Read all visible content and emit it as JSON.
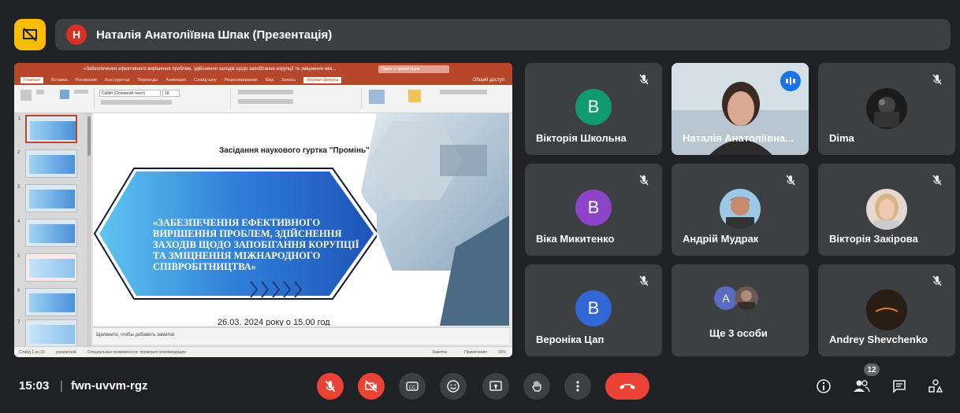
{
  "presenter": {
    "avatar_letter": "Н",
    "name": "Наталія Анатоліївна Шпак (Презентація)"
  },
  "powerpoint": {
    "title": "«Забезпечення ефективного вирішення проблем, здійснення заходів щодо запобігання корупції та зміцнення між...",
    "search_placeholder": "Поиск в презентации",
    "tabs": [
      "Главная",
      "Вставка",
      "Рисование",
      "Конструктор",
      "Переходы",
      "Анимация",
      "Слайд-шоу",
      "Рецензирование",
      "Вид",
      "Запись",
      "Формат фигуры"
    ],
    "share": "Общий доступ",
    "font_name": "Calibri (Основной текст)",
    "font_size": "18",
    "thumb_numbers": [
      "1",
      "2",
      "3",
      "4",
      "5",
      "6",
      "7"
    ],
    "slide": {
      "header": "Засідання наукового гуртка \"Промінь\"",
      "main_text": "«Забезпечення ефективного вирішення проблем, здійснення заходів щодо запобігання корупції та зміцнення міжнародного співробітництва»",
      "date": "26.03. 2024 року о 15.00 год"
    },
    "notes": "Щелкните, чтобы добавить заметки",
    "status_left": "Слайд 1 из 33",
    "status_lang": "украинский",
    "status_access": "Специальные возможности: проверьте рекомендации",
    "status_notes": "Заметки",
    "status_comments": "Примечания",
    "status_zoom": "93%"
  },
  "participants": [
    {
      "name": "Вікторія Школьна",
      "letter": "В",
      "color": "#129a6f"
    },
    {
      "name": "Наталія Анатоліївна...",
      "speaking": true
    },
    {
      "name": "Dima"
    },
    {
      "name": "Віка Микитенко",
      "letter": "В",
      "color": "#8e44c9"
    },
    {
      "name": "Андрій Мудрак"
    },
    {
      "name": "Вікторія Закірова"
    },
    {
      "name": "Вероніка Цап",
      "letter": "В",
      "color": "#3367d6"
    },
    {
      "name": "Ще 3 особи",
      "letter": "A",
      "color": "#5b6bc0"
    },
    {
      "name": "Andrey Shevchenko"
    }
  ],
  "meeting": {
    "time": "15:03",
    "separator": "|",
    "code": "fwn-uvvm-rgz",
    "participants_count": "12"
  },
  "colors": {
    "background": "#202124",
    "tile": "#3c4043",
    "danger": "#ea4335",
    "accent": "#1a73e8",
    "present": "#fbbc04"
  }
}
